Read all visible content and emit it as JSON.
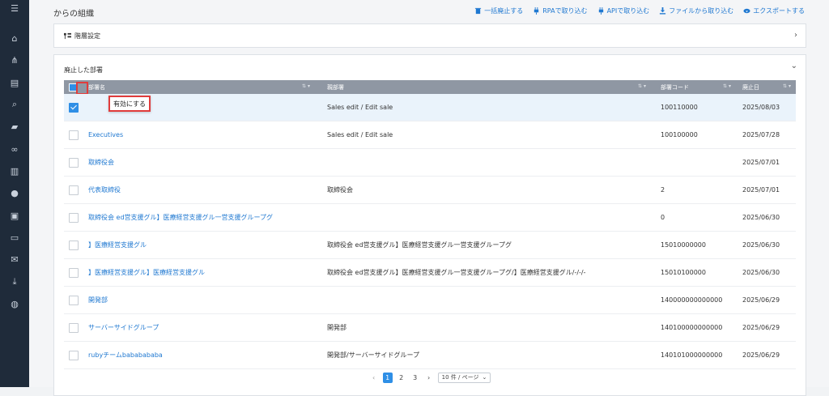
{
  "sidebar": {
    "icons": [
      "menu-icon",
      "home-icon",
      "org-chart-icon",
      "document-icon",
      "search-icon",
      "chat-icon",
      "link-icon",
      "chart-icon",
      "info-icon",
      "contact-card-icon",
      "book-icon",
      "mail-icon",
      "download-icon",
      "user-settings-icon"
    ]
  },
  "header": {
    "title": "からの組織",
    "actions": [
      {
        "label": "一括廃止する",
        "icon": "trash-icon"
      },
      {
        "label": "RPAで取り込む",
        "icon": "plug-icon"
      },
      {
        "label": "APIで取り込む",
        "icon": "plug-icon"
      },
      {
        "label": "ファイルから取り込む",
        "icon": "download-icon"
      },
      {
        "label": "エクスポートする",
        "icon": "cloud-download-icon"
      }
    ]
  },
  "panel_hierarchy": {
    "title": "階層設定"
  },
  "panel_abolished": {
    "title": "廃止した部署"
  },
  "table": {
    "columns": [
      "部署名",
      "親部署",
      "部署コード",
      "廃止日"
    ],
    "rows": [
      {
        "name": "",
        "parent": "Sales edit / Edit sale",
        "code": "100110000",
        "date": "2025/08/03",
        "checked": true
      },
      {
        "name": "Executives",
        "parent": "Sales edit / Edit sale",
        "code": "100100000",
        "date": "2025/07/28",
        "checked": false
      },
      {
        "name": "取締役会",
        "parent": "",
        "code": "",
        "date": "2025/07/01",
        "checked": false
      },
      {
        "name": "代表取締役",
        "parent": "取締役会",
        "code": "2",
        "date": "2025/07/01",
        "checked": false
      },
      {
        "name": "取締役会 ed営支援グル】医療経営支援グル一営支援グループグ",
        "parent": "",
        "code": "0",
        "date": "2025/06/30",
        "checked": false
      },
      {
        "name": "】医療経営支援グル",
        "parent": "取締役会 ed営支援グル】医療経営支援グル一営支援グループグ",
        "code": "15010000000",
        "date": "2025/06/30",
        "checked": false
      },
      {
        "name": "】医療経営支援グル】医療経営支援グル",
        "parent": "取締役会 ed営支援グル】医療経営支援グル一営支援グループグ/】医療経営支援グル/-/-/-",
        "code": "15010100000",
        "date": "2025/06/30",
        "checked": false
      },
      {
        "name": "開発部",
        "parent": "",
        "code": "140000000000000",
        "date": "2025/06/29",
        "checked": false
      },
      {
        "name": "サーバーサイドグループ",
        "parent": "開発部",
        "code": "140100000000000",
        "date": "2025/06/29",
        "checked": false
      },
      {
        "name": "rubyチームbababababa",
        "parent": "開発部/サーバーサイドグループ",
        "code": "140101000000000",
        "date": "2025/06/29",
        "checked": false
      }
    ]
  },
  "popup": {
    "label": "有効にする"
  },
  "pagination": {
    "pages": [
      "1",
      "2",
      "3"
    ],
    "current": "1",
    "per_page": "10 件 / ページ",
    "prev": "‹",
    "next": "›"
  }
}
